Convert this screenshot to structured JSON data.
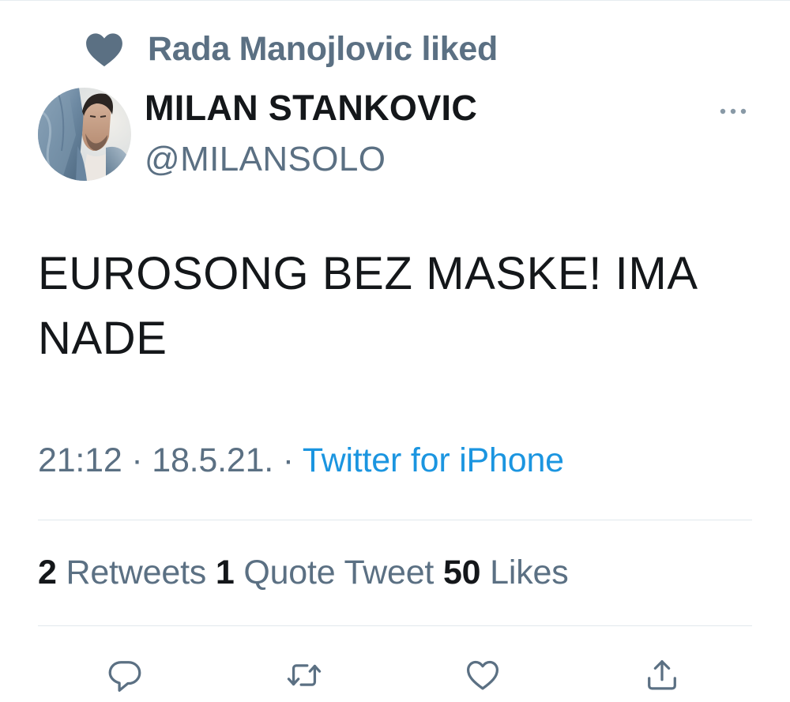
{
  "social_context": {
    "icon": "heart-icon",
    "text": "Rada Manojlovic liked"
  },
  "author": {
    "name": "MILAN STANKOVIC",
    "handle": "@MILANSOLO",
    "avatar_icon": "avatar-photo"
  },
  "more_icon": "more-horizontal-icon",
  "tweet": {
    "text": "EUROSONG BEZ MASKE! IMA NADE"
  },
  "meta": {
    "time": "21:12",
    "separator_1": " · ",
    "date": "18.5.21.",
    "separator_2": " · ",
    "source": "Twitter for iPhone"
  },
  "stats": {
    "retweets_count": "2",
    "retweets_label": "Retweets",
    "quotes_count": "1",
    "quotes_label": "Quote Tweet",
    "likes_count": "50",
    "likes_label": "Likes"
  },
  "actions": {
    "reply_icon": "reply-icon",
    "retweet_icon": "retweet-icon",
    "like_icon": "like-icon",
    "share_icon": "share-icon"
  },
  "colors": {
    "text_primary": "#14171a",
    "text_secondary": "#5b7083",
    "link": "#1b95e0",
    "divider": "#e1e8ed"
  }
}
